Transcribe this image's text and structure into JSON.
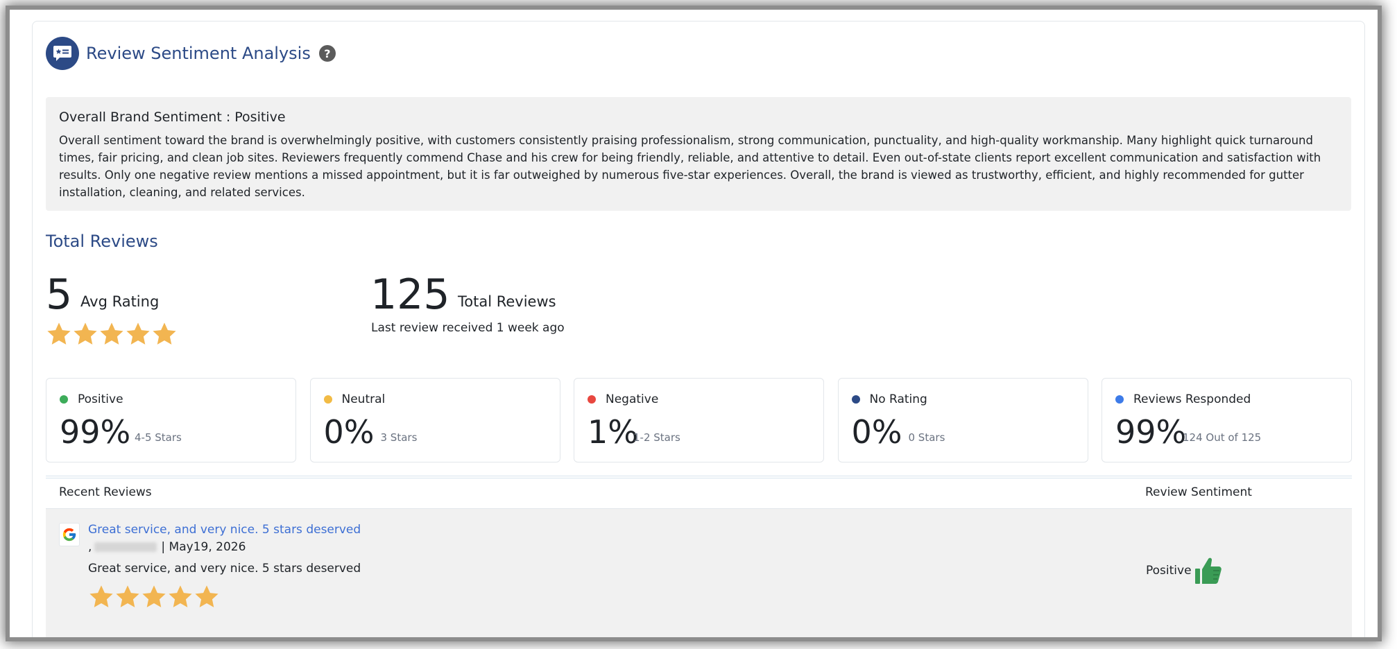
{
  "header": {
    "title": "Review Sentiment Analysis",
    "help_glyph": "?"
  },
  "summary": {
    "title": "Overall Brand Sentiment : Positive",
    "text": "Overall sentiment toward the brand is overwhelmingly positive, with customers consistently praising professionalism, strong communication, punctuality, and high-quality workmanship. Many highlight quick turnaround times, fair pricing, and clean job sites. Reviewers frequently commend Chase and his crew for being friendly, reliable, and attentive to detail. Even out-of-state clients report excellent communication and satisfaction with results. Only one negative review mentions a missed appointment, but it is far outweighed by numerous five-star experiences. Overall, the brand is viewed as trustworthy, efficient, and highly recommended for gutter installation, cleaning, and related services."
  },
  "totals": {
    "section_title": "Total Reviews",
    "avg_rating_value": "5",
    "avg_rating_label": "Avg Rating",
    "avg_rating_stars": 5,
    "total_value": "125",
    "total_label": "Total Reviews",
    "last_review": "Last review received 1 week ago"
  },
  "metrics": [
    {
      "label": "Positive",
      "value": "99%",
      "sub": "4-5 Stars",
      "color": "#3dac5a"
    },
    {
      "label": "Neutral",
      "value": "0%",
      "sub": "3 Stars",
      "color": "#f2bb45"
    },
    {
      "label": "Negative",
      "value": "1%",
      "sub": "1-2 Stars",
      "color": "#e8473f"
    },
    {
      "label": "No Rating",
      "value": "0%",
      "sub": "0 Stars",
      "color": "#2c4a86"
    },
    {
      "label": "Reviews Responded",
      "value": "99%",
      "sub": "124 Out of 125",
      "color": "#3d7be8"
    }
  ],
  "recent": {
    "col_reviews": "Recent Reviews",
    "col_sentiment": "Review Sentiment",
    "rows": [
      {
        "title": "Great service, and very nice. 5 stars deserved",
        "author_prefix": ",",
        "date": "| May19, 2026",
        "body": "Great service, and very nice. 5 stars deserved",
        "stars": 5,
        "sentiment": "Positive"
      }
    ]
  },
  "colors": {
    "brand": "#2c4a86",
    "star": "#f2b551",
    "thumb": "#3a9b55",
    "link": "#3d6fd4"
  }
}
